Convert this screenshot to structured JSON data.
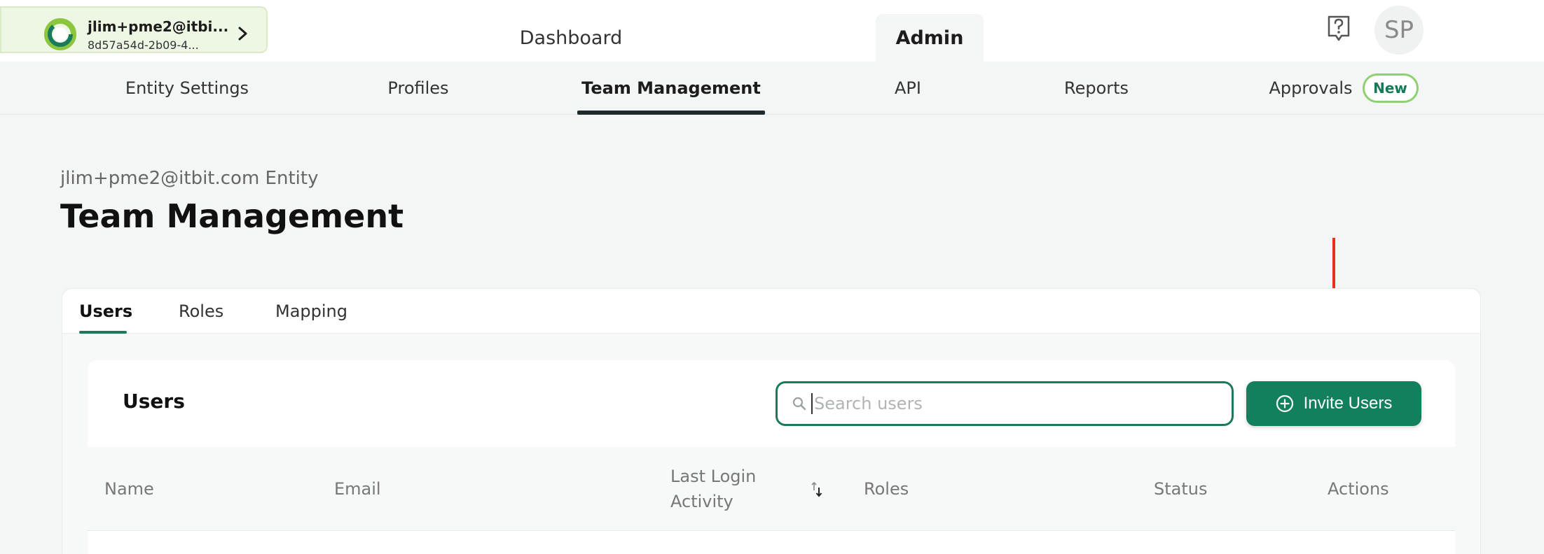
{
  "header": {
    "entity": {
      "name": "jlim+pme2@itbi...",
      "id": "8d57a54d-2b09-4..."
    },
    "tabs": [
      {
        "label": "Dashboard",
        "active": false
      },
      {
        "label": "Admin",
        "active": true
      }
    ],
    "help_icon": "question-mark-icon",
    "avatar_initials": "SP"
  },
  "subnav": {
    "items": [
      {
        "label": "Entity Settings"
      },
      {
        "label": "Profiles"
      },
      {
        "label": "Team Management",
        "active": true
      },
      {
        "label": "API"
      },
      {
        "label": "Reports"
      },
      {
        "label": "Approvals",
        "badge": "New"
      }
    ]
  },
  "page": {
    "entity_label": "jlim+pme2@itbit.com Entity",
    "title": "Team Management"
  },
  "card": {
    "tabs": [
      {
        "label": "Users",
        "active": true
      },
      {
        "label": "Roles"
      },
      {
        "label": "Mapping"
      }
    ]
  },
  "users": {
    "title": "Users",
    "search_placeholder": "Search users",
    "search_value": "",
    "invite_label": "Invite Users",
    "columns": {
      "name": "Name",
      "email": "Email",
      "last_login_line1": "Last Login",
      "last_login_line2": "Activity",
      "roles": "Roles",
      "status": "Status",
      "actions": "Actions"
    }
  },
  "colors": {
    "accent": "#12805c",
    "badge_border": "#8fd071",
    "annotation_arrow": "#e8311c"
  }
}
